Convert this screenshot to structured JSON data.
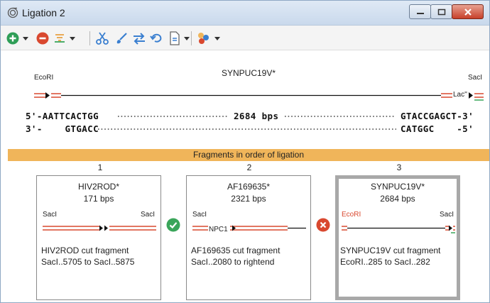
{
  "window": {
    "title": "Ligation 2"
  },
  "toolbar": {
    "items": [
      "add-icon",
      "remove-icon",
      "sort-icon",
      "scissors-icon",
      "brush-icon",
      "swap-icon",
      "undo-icon",
      "document-icon",
      "color-icon"
    ]
  },
  "map": {
    "title": "SYNPUC19V*",
    "left_site": "EcoRI",
    "right_site": "SacI",
    "feature_label": "Lac''",
    "top_left_seq": "5'-AATTCACTGG",
    "length_label": "2684 bps",
    "top_right_seq": "GTACCGAGCT-3'",
    "bottom_left_seq": "3'-    GTGACC",
    "bottom_right_seq": "CATGGC    -5'"
  },
  "fragments_header": "Fragments in order of ligation",
  "colors": {
    "accent": "#f0b55a",
    "ok": "#3aa55a",
    "error": "#d9482f",
    "ecori_red": "#d9482f"
  },
  "fragments": [
    {
      "number": "1",
      "name": "HIV2ROD*",
      "length": "171 bps",
      "left_site": "SacI",
      "right_site": "SacI",
      "desc_line1": "HIV2ROD cut fragment",
      "desc_line2": "SacI..5705 to SacI..5875"
    },
    {
      "number": "2",
      "name": "AF169635*",
      "length": "2321 bps",
      "left_site": "SacI",
      "right_site": "",
      "feature": "NPC1",
      "desc_line1": "AF169635 cut fragment",
      "desc_line2": "SacI..2080 to rightend"
    },
    {
      "number": "3",
      "name": "SYNPUC19V*",
      "length": "2684 bps",
      "left_site": "EcoRI",
      "right_site": "SacI",
      "desc_line1": "SYNPUC19V cut fragment",
      "desc_line2": "EcoRI..285 to SacI..282"
    }
  ],
  "junctions": [
    "ok",
    "error"
  ]
}
